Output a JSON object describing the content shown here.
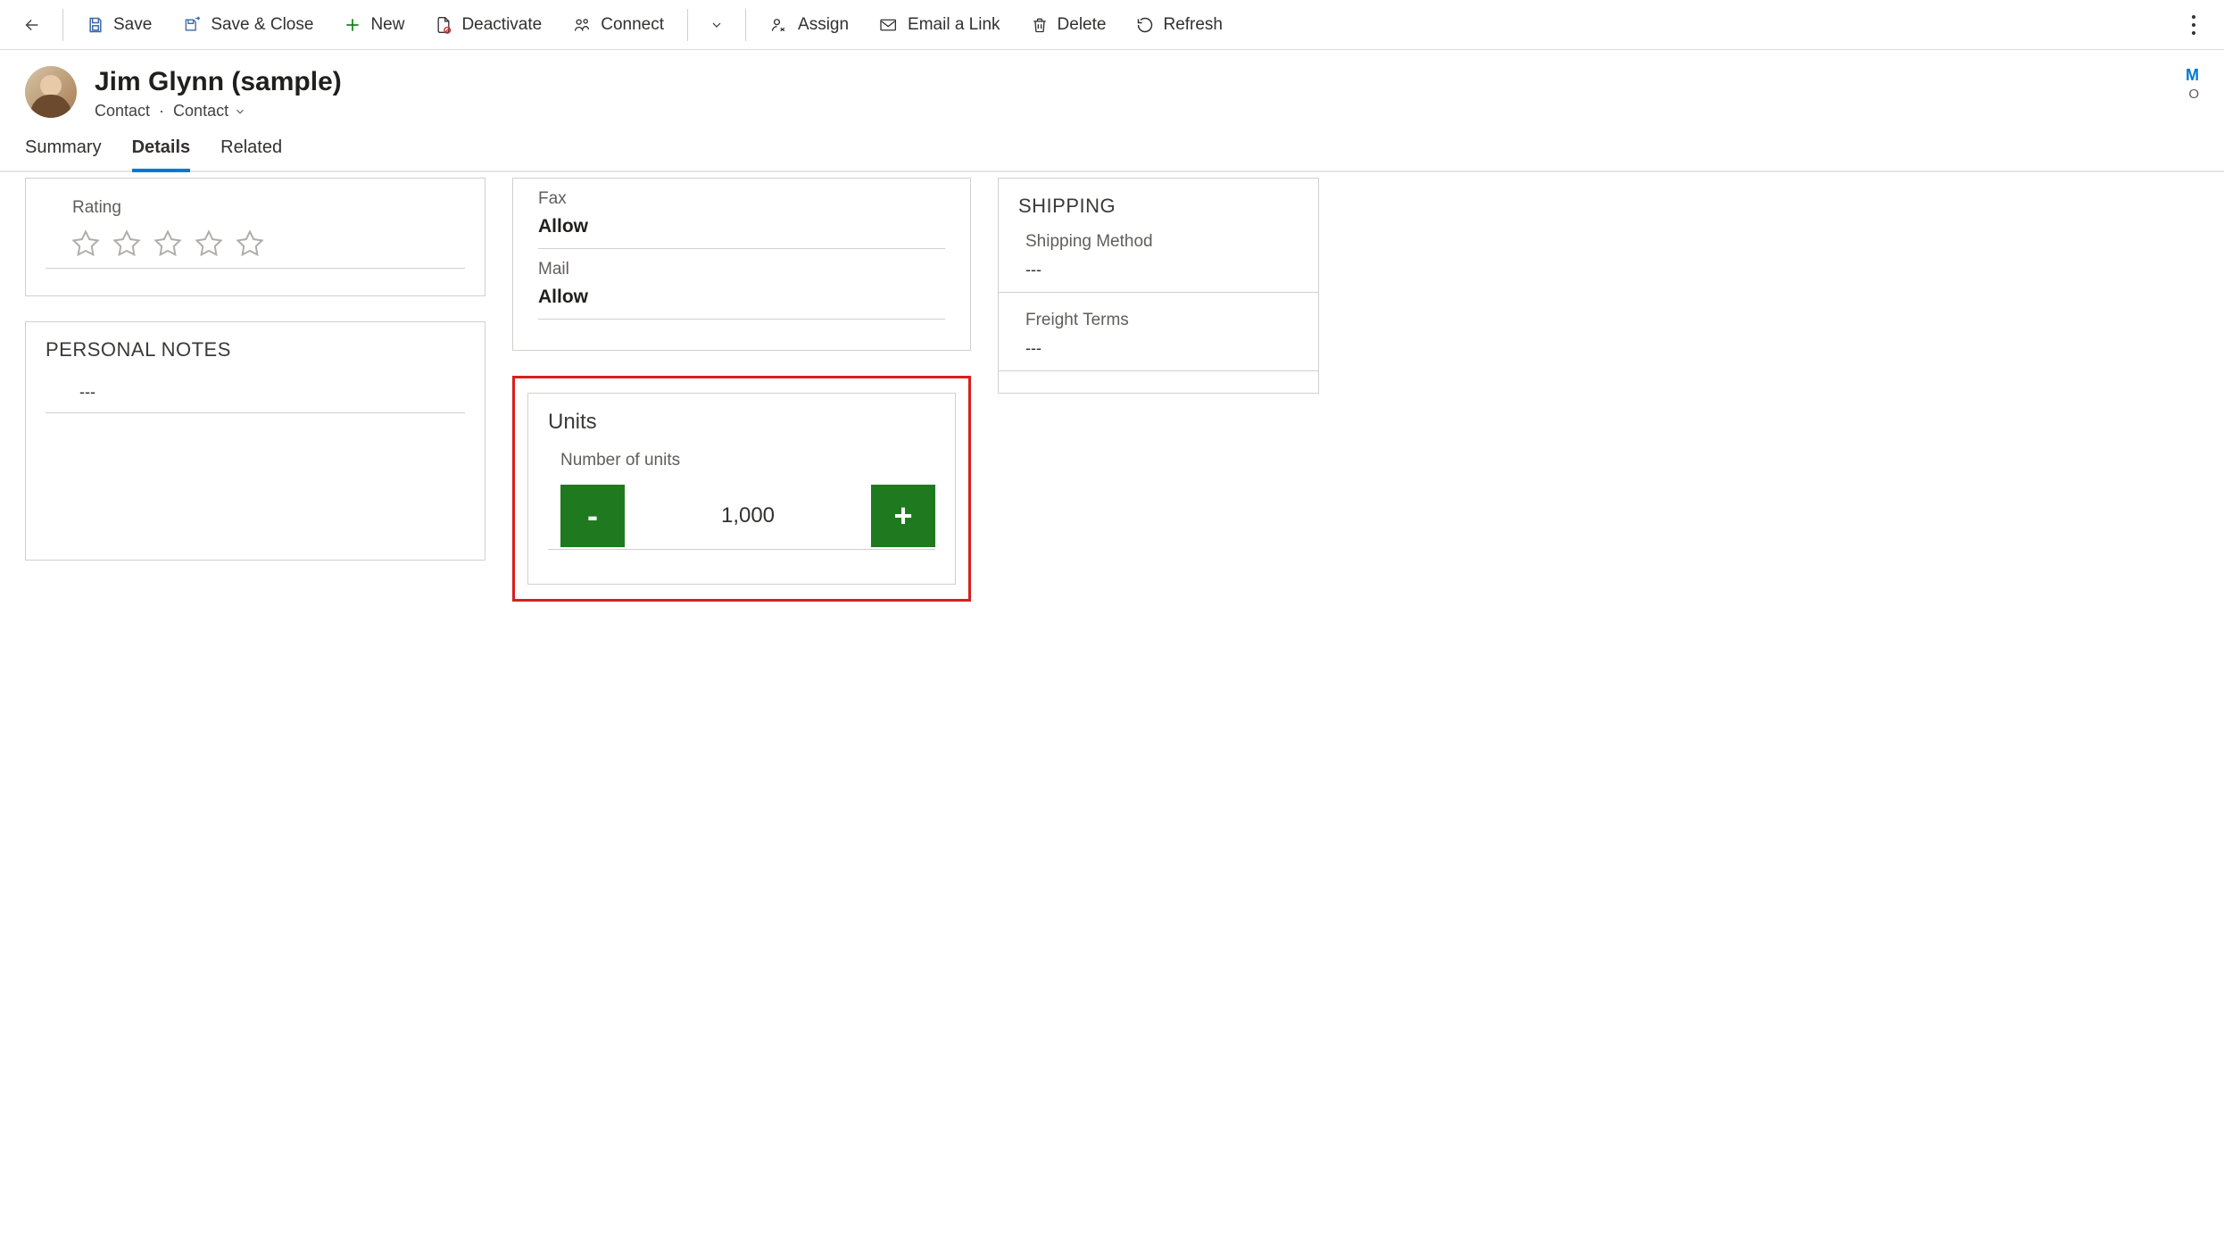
{
  "toolbar": {
    "save": "Save",
    "save_close": "Save & Close",
    "new": "New",
    "deactivate": "Deactivate",
    "connect": "Connect",
    "assign": "Assign",
    "email_link": "Email a Link",
    "delete": "Delete",
    "refresh": "Refresh"
  },
  "header": {
    "title": "Jim Glynn (sample)",
    "entity": "Contact",
    "form": "Contact",
    "right_initial": "M",
    "right_sub": "O"
  },
  "tabs": {
    "summary": "Summary",
    "details": "Details",
    "related": "Related"
  },
  "rating": {
    "label": "Rating"
  },
  "notes": {
    "title": "PERSONAL NOTES",
    "value": "---"
  },
  "contact_prefs": {
    "fax_label": "Fax",
    "fax_value": "Allow",
    "mail_label": "Mail",
    "mail_value": "Allow"
  },
  "units": {
    "section": "Units",
    "label": "Number of units",
    "value": "1,000",
    "minus": "-",
    "plus": "+"
  },
  "shipping": {
    "title": "SHIPPING",
    "method_label": "Shipping Method",
    "method_value": "---",
    "freight_label": "Freight Terms",
    "freight_value": "---"
  }
}
